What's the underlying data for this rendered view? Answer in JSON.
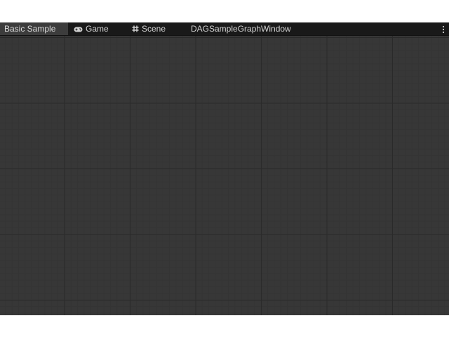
{
  "tabs": [
    {
      "label": "Basic Sample",
      "icon": "",
      "active": true
    },
    {
      "label": "Game",
      "icon": "gamepad-icon",
      "active": false
    },
    {
      "label": "Scene",
      "icon": "hash-grid-icon",
      "active": false
    },
    {
      "label": "DAGSampleGraphWindow",
      "icon": "",
      "active": false
    }
  ],
  "menu_icon": "kebab-menu-icon",
  "colors": {
    "tabbar_bg": "#191919",
    "active_tab_bg": "#3c3c3c",
    "canvas_bg": "#373737",
    "grid_major": "#2a2a2a",
    "grid_minor": "#343434",
    "text": "#d2d2d2"
  }
}
